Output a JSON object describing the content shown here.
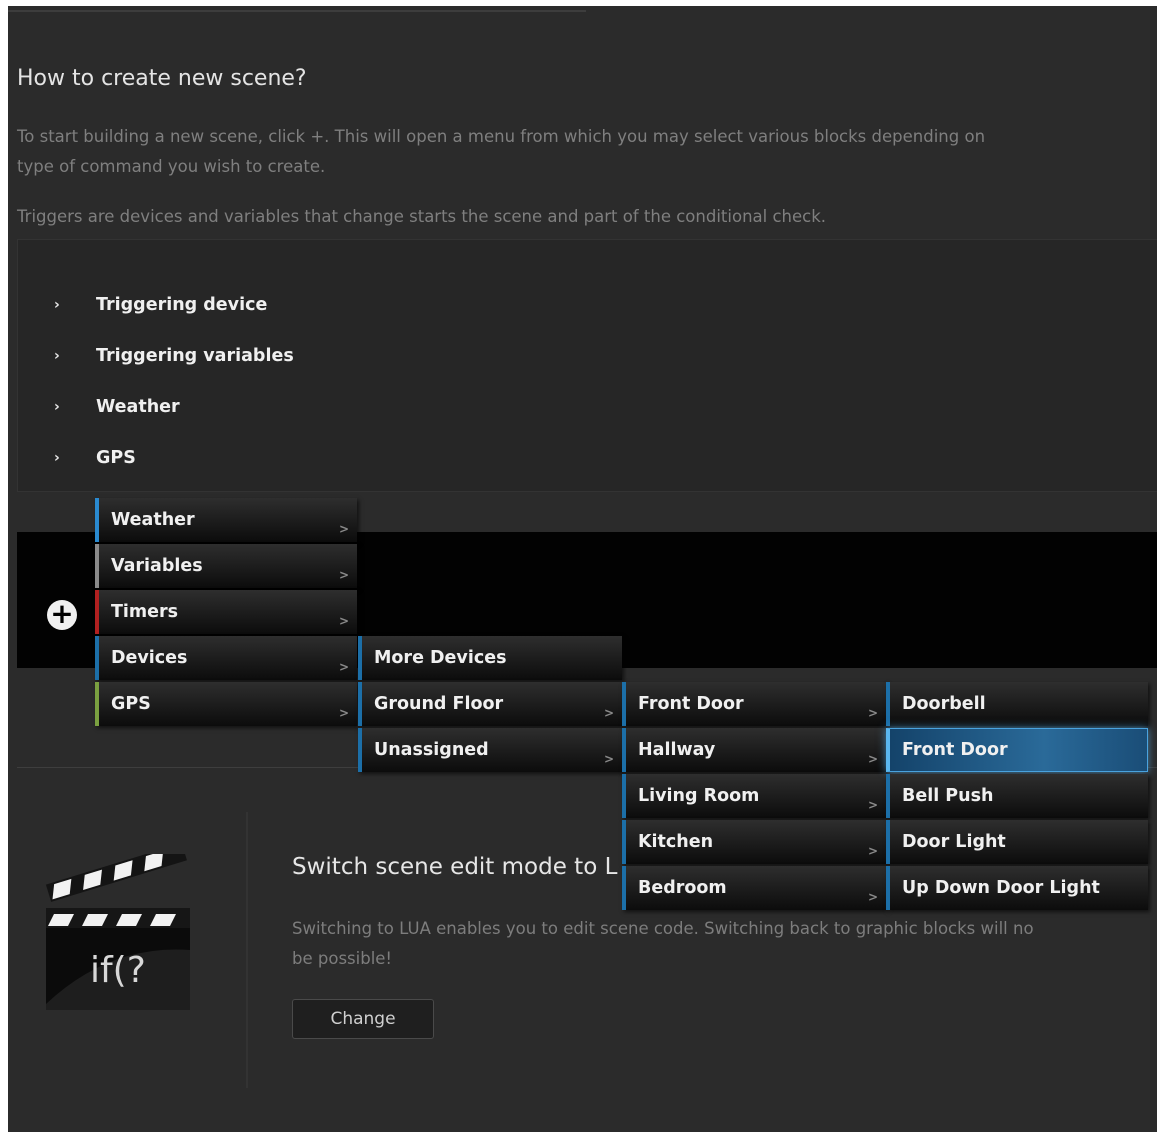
{
  "header": {
    "title": "How to create new scene?"
  },
  "intro": {
    "line1": "To start building a new scene, click +. This will open a menu from which you may select various blocks depending on",
    "line2": "type of command you wish to create.",
    "triggers_note": "Triggers are devices and variables that change starts the scene and part of the conditional check."
  },
  "triggers": {
    "arrow": "›",
    "items": [
      {
        "label": "Triggering device"
      },
      {
        "label": "Triggering variables"
      },
      {
        "label": "Weather"
      },
      {
        "label": "GPS"
      }
    ]
  },
  "add_button": {
    "symbol": "+"
  },
  "menu": {
    "submenu_arrow": ">",
    "level1": [
      {
        "label": "Weather",
        "accent": "#2a8ad0"
      },
      {
        "label": "Variables",
        "accent": "#8a8a8a"
      },
      {
        "label": "Timers",
        "accent": "#b02020"
      },
      {
        "label": "Devices",
        "accent": "#1c6fa8"
      },
      {
        "label": "GPS",
        "accent": "#7aa040"
      }
    ],
    "level2": [
      {
        "label": "More Devices"
      },
      {
        "label": "Ground Floor"
      },
      {
        "label": "Unassigned"
      }
    ],
    "level3": [
      {
        "label": "Front Door"
      },
      {
        "label": "Hallway"
      },
      {
        "label": "Living Room"
      },
      {
        "label": "Kitchen"
      },
      {
        "label": "Bedroom"
      }
    ],
    "level4": [
      {
        "label": "Doorbell"
      },
      {
        "label": "Front Door",
        "selected": true
      },
      {
        "label": "Bell Push"
      },
      {
        "label": "Door Light"
      },
      {
        "label": "Up Down Door Light"
      }
    ]
  },
  "lua_section": {
    "icon": "clapperboard-icon",
    "icon_text": "if(?",
    "title": "Switch scene edit mode to L",
    "desc_line1": "Switching to LUA enables you to edit scene code. Switching back to graphic blocks will no",
    "desc_line2": "be possible!",
    "button_label": "Change"
  }
}
